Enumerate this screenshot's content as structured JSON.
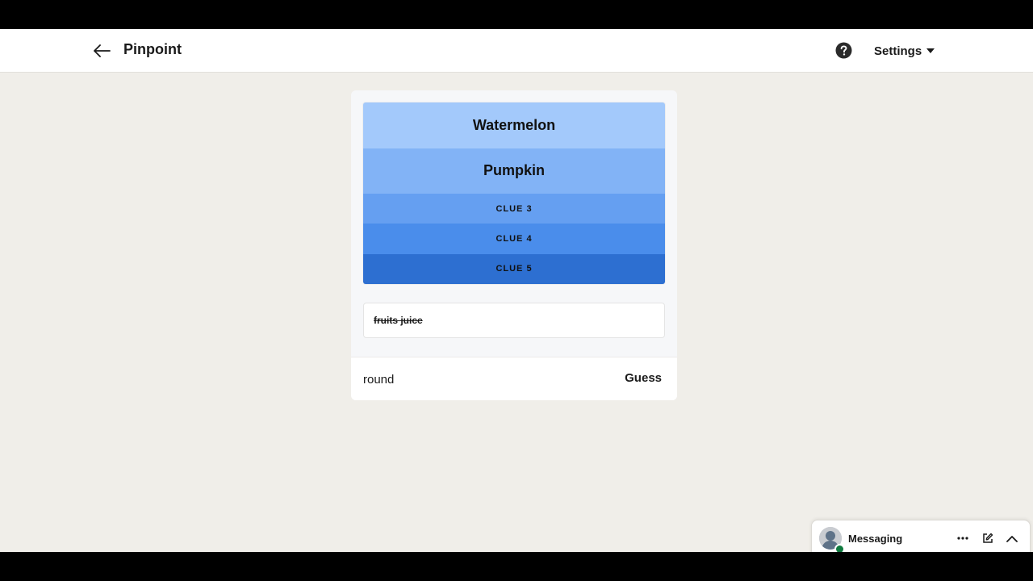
{
  "header": {
    "title": "Pinpoint",
    "back_icon": "arrow-left-icon",
    "help_icon": "question-circle-icon",
    "settings_label": "Settings",
    "settings_icon": "caret-down-icon"
  },
  "game": {
    "clues": [
      {
        "label": "Watermelon",
        "state": "revealed",
        "color": "#a3c9fb"
      },
      {
        "label": "Pumpkin",
        "state": "revealed",
        "color": "#82b3f6"
      },
      {
        "label": "CLUE 3",
        "state": "hidden",
        "color": "#659ff1"
      },
      {
        "label": "CLUE 4",
        "state": "hidden",
        "color": "#4a8deb"
      },
      {
        "label": "CLUE 5",
        "state": "hidden",
        "color": "#2d6fd1"
      }
    ],
    "previous_guesses": [
      {
        "text": "fruits juice",
        "result": "incorrect"
      }
    ],
    "input_value": "round",
    "guess_button": "Guess"
  },
  "messaging": {
    "label": "Messaging",
    "presence": "online",
    "icons": [
      "ellipsis-icon",
      "compose-icon",
      "chevron-up-icon"
    ]
  },
  "colors": {
    "background": "#f0eee9",
    "card": "#f6f7f9",
    "presence_green": "#107a3f"
  }
}
